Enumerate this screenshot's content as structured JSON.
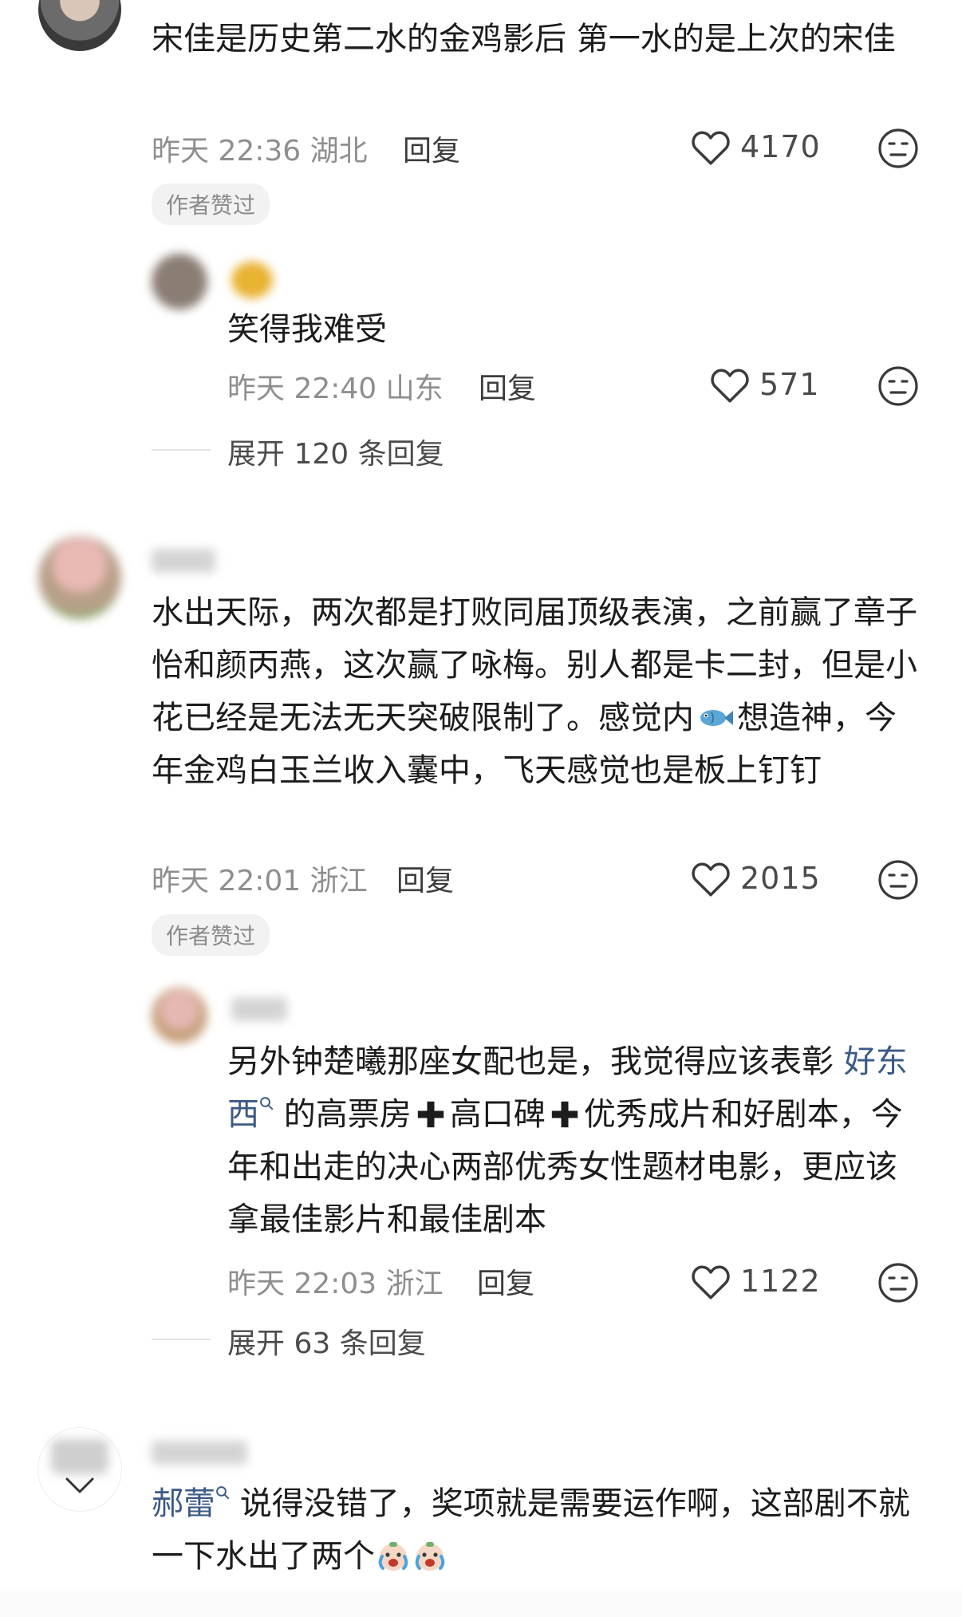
{
  "comments": [
    {
      "text": "宋佳是历史第二水的金鸡影后  第一水的是上次的宋佳",
      "time": "昨天 22:36 湖北",
      "reply_label": "回复",
      "likes": "4170",
      "badge": "作者赞过",
      "reply": {
        "text": "笑得我难受",
        "time": "昨天 22:40 山东",
        "reply_label": "回复",
        "likes": "571"
      },
      "expand": "展开 120 条回复"
    },
    {
      "text": "水出天际，两次都是打败同届顶级表演，之前赢了章子怡和颜丙燕，这次赢了咏梅。别人都是卡二封，但是小花已经是无法无天突破限制了。感觉内",
      "text_after_icon": "想造神，今年金鸡白玉兰收入囊中，飞天感觉也是板上钉钉",
      "time": "昨天 22:01 浙江",
      "reply_label": "回复",
      "likes": "2015",
      "badge": "作者赞过",
      "reply": {
        "text_before_link": "另外钟楚曦那座女配也是，我觉得应该表彰 ",
        "link": "好东西",
        "text_part2": " 的高票房",
        "text_part3": "高口碑",
        "text_part4": "优秀成片和好剧本，今年和出走的决心两部优秀女性题材电影，更应该拿最佳影片和最佳剧本",
        "time": "昨天 22:03 浙江",
        "reply_label": "回复",
        "likes": "1122"
      },
      "expand": "展开 63 条回复"
    },
    {
      "link": "郝蕾",
      "text": " 说得没错了，奖项就是需要运作啊，这部剧不就一下水出了两个"
    }
  ],
  "icons": {
    "like": "heart-outline-icon",
    "dislike": "unhappy-face-icon",
    "search_hint": "search-magnifier-icon",
    "fish": "fish-emoji-icon",
    "plus": "heavy-plus-icon",
    "crying": "crying-face-emoji-icon",
    "collapse": "chevron-down-icon"
  },
  "colors": {
    "link": "#3b5a86",
    "meta": "#8e8e8e",
    "badge_bg": "#f2f2f2"
  }
}
